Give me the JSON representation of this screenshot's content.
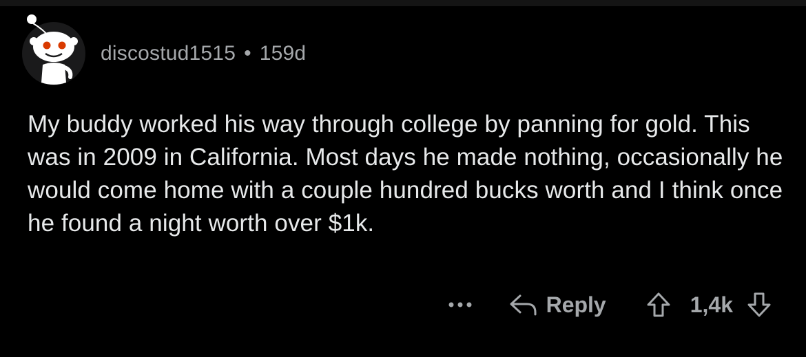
{
  "comment": {
    "username": "discostud1515",
    "separator": "•",
    "age": "159d",
    "body": "My buddy worked his way through college by panning for gold.  This was in 2009 in California.  Most days he made nothing, occasionally he would come home with a couple hundred bucks worth and I think once he found a night worth over $1k.",
    "avatar_icon": "snoo-avatar-icon"
  },
  "actions": {
    "more_icon": "more-options-icon",
    "reply_icon": "reply-arrow-icon",
    "reply_label": "Reply",
    "upvote_icon": "upvote-arrow-icon",
    "score": "1,4k",
    "downvote_icon": "downvote-arrow-icon"
  },
  "colors": {
    "background": "#000000",
    "text": "#e7e9ea",
    "meta": "#a5a8ab",
    "avatar_bg": "#1a1a1b"
  }
}
